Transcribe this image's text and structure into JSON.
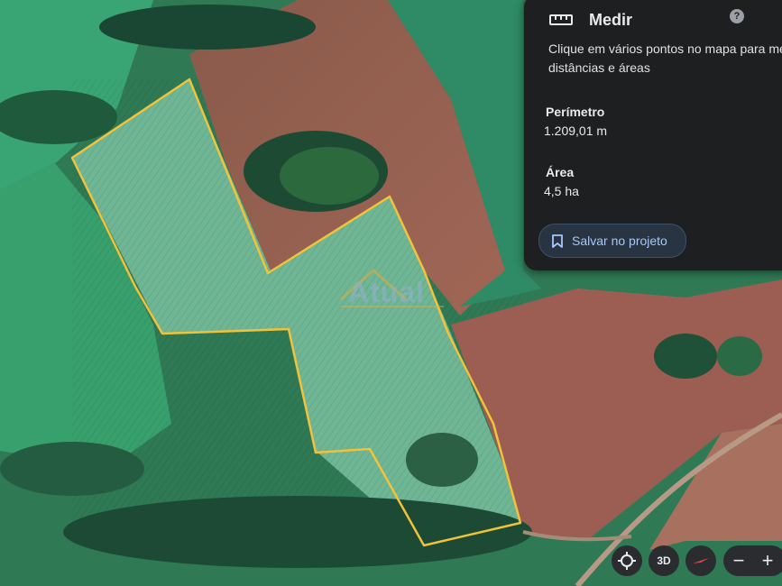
{
  "measure_panel": {
    "title": "Medir",
    "title_icon": "ruler-icon",
    "help_icon": "help-icon",
    "instructions": "Clique em vários pontos no mapa para medir distâncias e áreas",
    "perimeter_label": "Perímetro",
    "perimeter_value": "1.209,01 m",
    "area_label": "Área",
    "area_value": "4,5 ha",
    "save_button_label": "Salvar no projeto",
    "save_button_icon": "bookmark-icon",
    "accent_color": "#a8c7fa"
  },
  "map": {
    "type": "satellite",
    "polygon_color": "#f2c23a",
    "watermark": "Atual"
  },
  "map_controls": {
    "locate_icon": "locate-icon",
    "view_3d_label": "3D",
    "compass_icon": "compass-icon",
    "zoom_out_label": "−",
    "zoom_in_label": "+"
  }
}
